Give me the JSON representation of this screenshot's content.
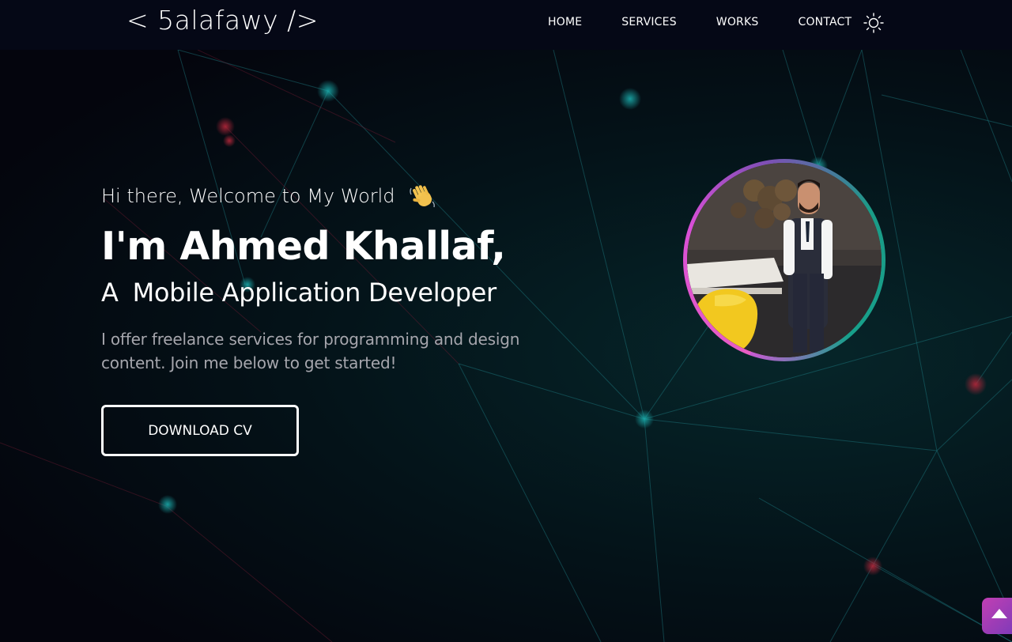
{
  "navbar": {
    "logo": "< 5alafawy />",
    "links": [
      "HOME",
      "SERVICES",
      "WORKS",
      "CONTACT"
    ],
    "theme_icon": "sun-icon"
  },
  "hero": {
    "greeting": "Hi there, Welcome to My World",
    "greeting_icon": "waving-hand-icon",
    "name": "I'm Ahmed Khallaf,",
    "role_prefix": "A",
    "role": "Mobile Application Developer",
    "intro": "I offer freelance services for programming and design content. Join me below to get started!",
    "cta_label": "DOWNLOAD CV"
  },
  "scroll_top": {
    "icon": "arrow-up-icon"
  },
  "colors": {
    "background": "#030712",
    "accent_pink": "#e95dc3",
    "accent_teal": "#17a08b",
    "muted_text": "#a6a6ad"
  }
}
